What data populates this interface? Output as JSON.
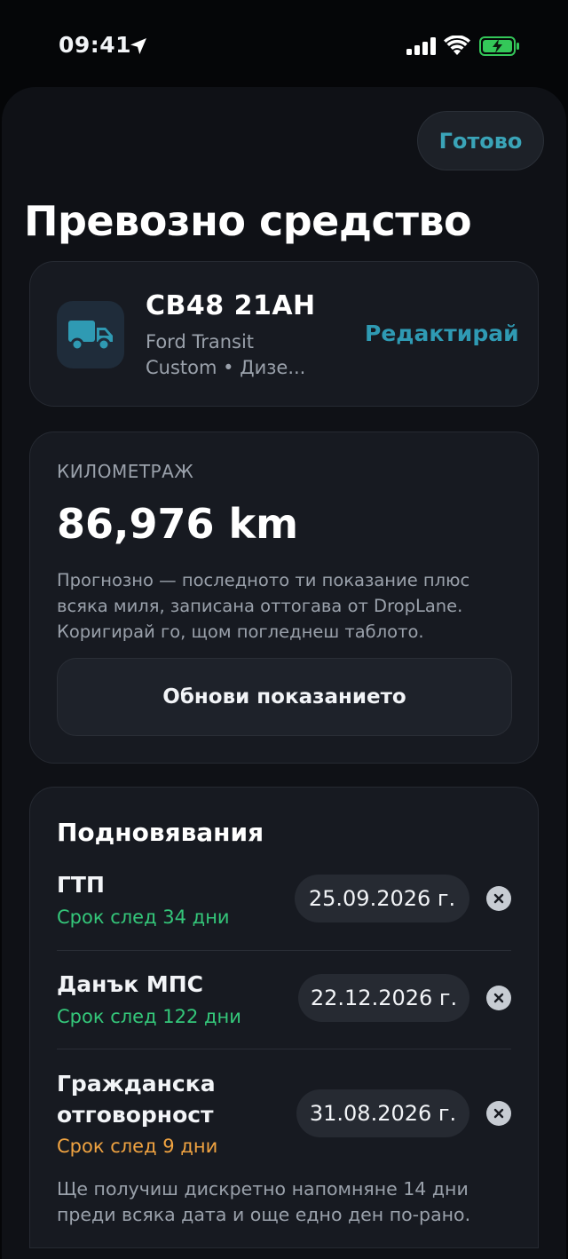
{
  "status_bar": {
    "time": "09:41",
    "battery_color": "#34c759"
  },
  "header": {
    "done_label": "Готово",
    "title": "Превозно средство",
    "accent_color": "#3aa4b8"
  },
  "vehicle": {
    "icon": "truck-icon",
    "plate": "СВ48 21АН",
    "model": "Ford Transit Custom • Дизе...",
    "edit_label": "Редактирай"
  },
  "odometer": {
    "label": "КИЛОМЕТРАЖ",
    "value": "86,976 km",
    "note": "Прогнозно — последното ти показание плюс всяка миля, записана оттогава от DropLane. Коригирай го, щом погледнеш таблото.",
    "update_label": "Обнови показанието"
  },
  "renewals": {
    "title": "Подновявания",
    "items": [
      {
        "name": "ГТП",
        "due": "Срок след 34 дни",
        "date": "25.09.2026 г.",
        "status_color": "#34c77a"
      },
      {
        "name": "Данък МПС",
        "due": "Срок след 122 дни",
        "date": "22.12.2026 г.",
        "status_color": "#34c77a"
      },
      {
        "name": "Гражданска отговорност",
        "due": "Срок след 9 дни",
        "date": "31.08.2026 г.",
        "status_color": "#f0a341"
      }
    ],
    "footer": "Ще получиш дискретно напомняне 14 дни преди всяка дата и още едно ден по-рано."
  }
}
